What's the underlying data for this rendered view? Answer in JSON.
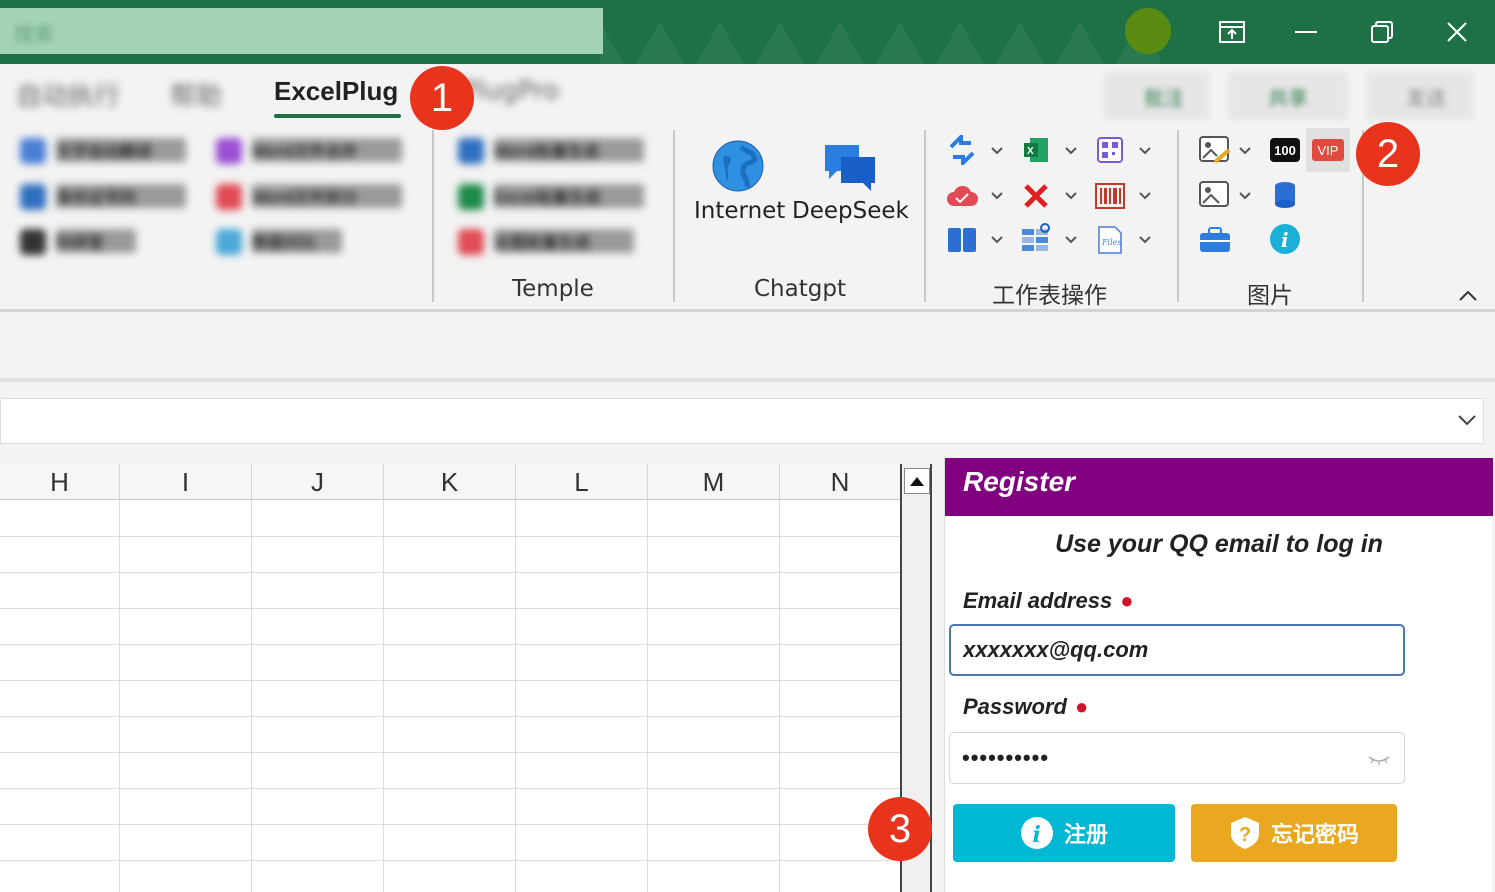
{
  "titlebar": {
    "search_placeholder": "搜索",
    "icons": [
      "ribbon-display-icon",
      "minimize-icon",
      "restore-icon",
      "close-icon"
    ]
  },
  "tabs": {
    "items": [
      "自动执行",
      "帮助",
      "ExcelPlug",
      "PlugPro"
    ],
    "active": "ExcelPlug",
    "top_buttons": [
      "批注",
      "共享",
      "发送"
    ]
  },
  "ribbon": {
    "blurred_items": [
      "文字自动翻译",
      "Word文件合并",
      "身份证号码",
      "Word文件拆分",
      "科研室",
      "数据对比",
      "Word批量生成",
      "Excel批量生成",
      "论图批量生成"
    ],
    "internet_label": "Internet",
    "deepseek_label": "DeepSeek",
    "groups": {
      "temple": "Temple",
      "chatgpt": "Chatgpt",
      "sheet_ops": "工作表操作",
      "pictures": "图片"
    },
    "icon_100_text": "100",
    "icon_vip_text": "VIP"
  },
  "badges": [
    "1",
    "2",
    "3"
  ],
  "grid": {
    "columns": [
      "H",
      "I",
      "J",
      "K",
      "L",
      "M",
      "N"
    ]
  },
  "register": {
    "title": "Register",
    "subtitle": "Use your QQ email to log in",
    "email_label": "Email address",
    "email_value": "xxxxxxx@qq.com",
    "password_label": "Password",
    "password_value": "••••••••••",
    "required_mark": "●",
    "register_button": "注册",
    "forgot_button": "忘记密码",
    "colors": {
      "header": "#800080",
      "register_btn": "#00b8d4",
      "forgot_btn": "#e9a820",
      "required": "#d0142c"
    }
  }
}
